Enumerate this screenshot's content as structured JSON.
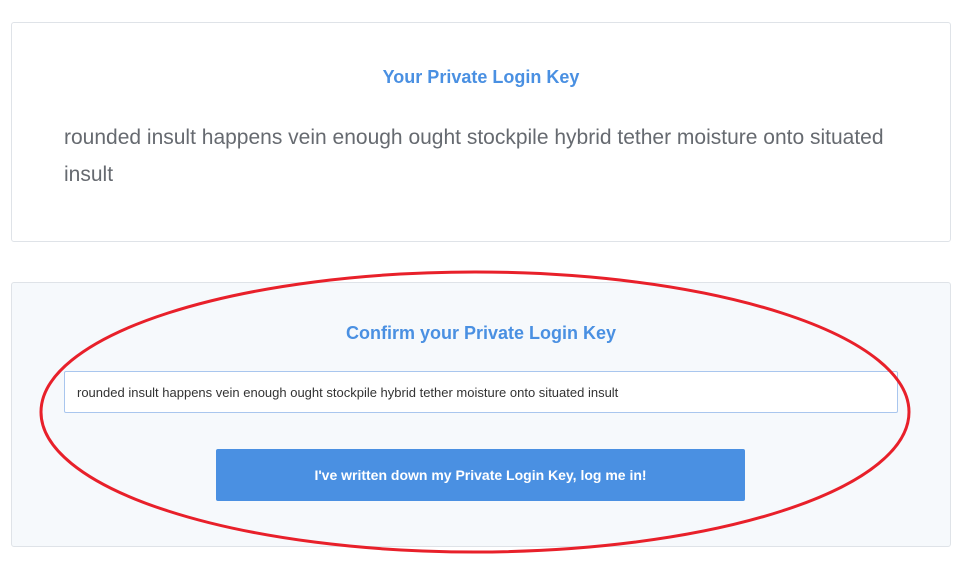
{
  "key_card": {
    "title": "Your Private Login Key",
    "key_phrase": "rounded insult happens vein enough ought stockpile hybrid tether moisture onto situated insult"
  },
  "confirm_card": {
    "title": "Confirm your Private Login Key",
    "input_value": "rounded insult happens vein enough ought stockpile hybrid tether moisture onto situated insult",
    "button_label": "I've written down my Private Login Key, log me in!"
  },
  "colors": {
    "accent": "#4a90e2",
    "annotation": "#e8202a",
    "confirm_background": "#f6f9fc"
  }
}
